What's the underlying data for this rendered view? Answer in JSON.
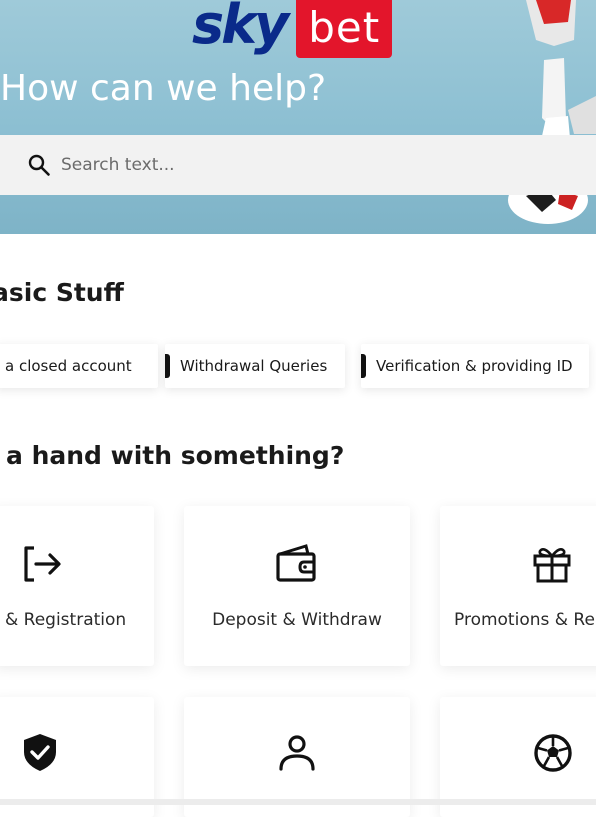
{
  "brand": {
    "part1": "sky",
    "part2": "bet"
  },
  "hero": {
    "title": "How can we help?"
  },
  "search": {
    "placeholder": "Search text..."
  },
  "basic_stuff": {
    "title": "asic Stuff",
    "chips": [
      {
        "label": "a closed account"
      },
      {
        "label": "Withdrawal Queries"
      },
      {
        "label": "Verification & providing ID"
      }
    ]
  },
  "help_section": {
    "title": "a hand with something?",
    "cards": [
      {
        "label": "& Registration",
        "icon": "login-icon"
      },
      {
        "label": "Deposit & Withdraw",
        "icon": "wallet-icon"
      },
      {
        "label": "Promotions & Re",
        "icon": "gift-icon"
      },
      {
        "label": "",
        "icon": "shield-check-icon"
      },
      {
        "label": "",
        "icon": "user-icon"
      },
      {
        "label": "",
        "icon": "football-icon"
      }
    ]
  },
  "colors": {
    "brand_blue": "#0a2a8a",
    "brand_red": "#e3152b",
    "hero_bg": "#9fcad9"
  }
}
